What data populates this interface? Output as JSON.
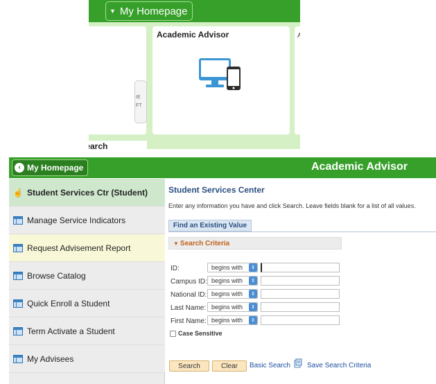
{
  "top_panel": {
    "home_label": "My Homepage",
    "tile_title": "Academic Advisor",
    "tile_left_lines": [
      "IE",
      "FT"
    ],
    "tile_right_text": "A",
    "tile_bottom_text": "t Search",
    "tile_icon": "desktop-and-phone-icon"
  },
  "header": {
    "home_label": "My Homepage",
    "title": "Academic Advisor",
    "back_icon": "chevron-left-icon"
  },
  "sidebar": {
    "items": [
      {
        "label": "Student Services Ctr (Student)",
        "icon": "hand-pointer-icon",
        "state": "active"
      },
      {
        "label": "Manage Service Indicators",
        "icon": "page-icon",
        "state": "normal"
      },
      {
        "label": "Request Advisement Report",
        "icon": "page-icon",
        "state": "highlight"
      },
      {
        "label": "Browse Catalog",
        "icon": "page-icon",
        "state": "normal"
      },
      {
        "label": "Quick Enroll a Student",
        "icon": "page-icon",
        "state": "normal"
      },
      {
        "label": "Term Activate a Student",
        "icon": "page-icon",
        "state": "normal"
      },
      {
        "label": "My Advisees",
        "icon": "page-icon",
        "state": "normal"
      }
    ]
  },
  "main": {
    "title": "Student Services Center",
    "instructions": "Enter any information you have and click Search. Leave fields blank for a list of all values.",
    "tab_label": "Find an Existing Value",
    "criteria_label": "Search Criteria",
    "fields": [
      {
        "label": "ID:",
        "operator": "begins with",
        "value": ""
      },
      {
        "label": "Campus ID:",
        "operator": "begins with",
        "value": ""
      },
      {
        "label": "National ID:",
        "operator": "begins with",
        "value": ""
      },
      {
        "label": "Last Name:",
        "operator": "begins with",
        "value": ""
      },
      {
        "label": "First Name:",
        "operator": "begins with",
        "value": ""
      }
    ],
    "case_sensitive_label": "Case Sensitive",
    "case_sensitive_checked": false,
    "search_label": "Search",
    "clear_label": "Clear",
    "basic_search_label": "Basic Search",
    "save_search_label": "Save Search Criteria"
  },
  "colors": {
    "header_green": "#37a02a",
    "tile_bg_green": "#d4f0c4",
    "link_blue": "#1e4ea0",
    "criteria_orange": "#c0621a",
    "button_tan": "#fbe6c0"
  }
}
